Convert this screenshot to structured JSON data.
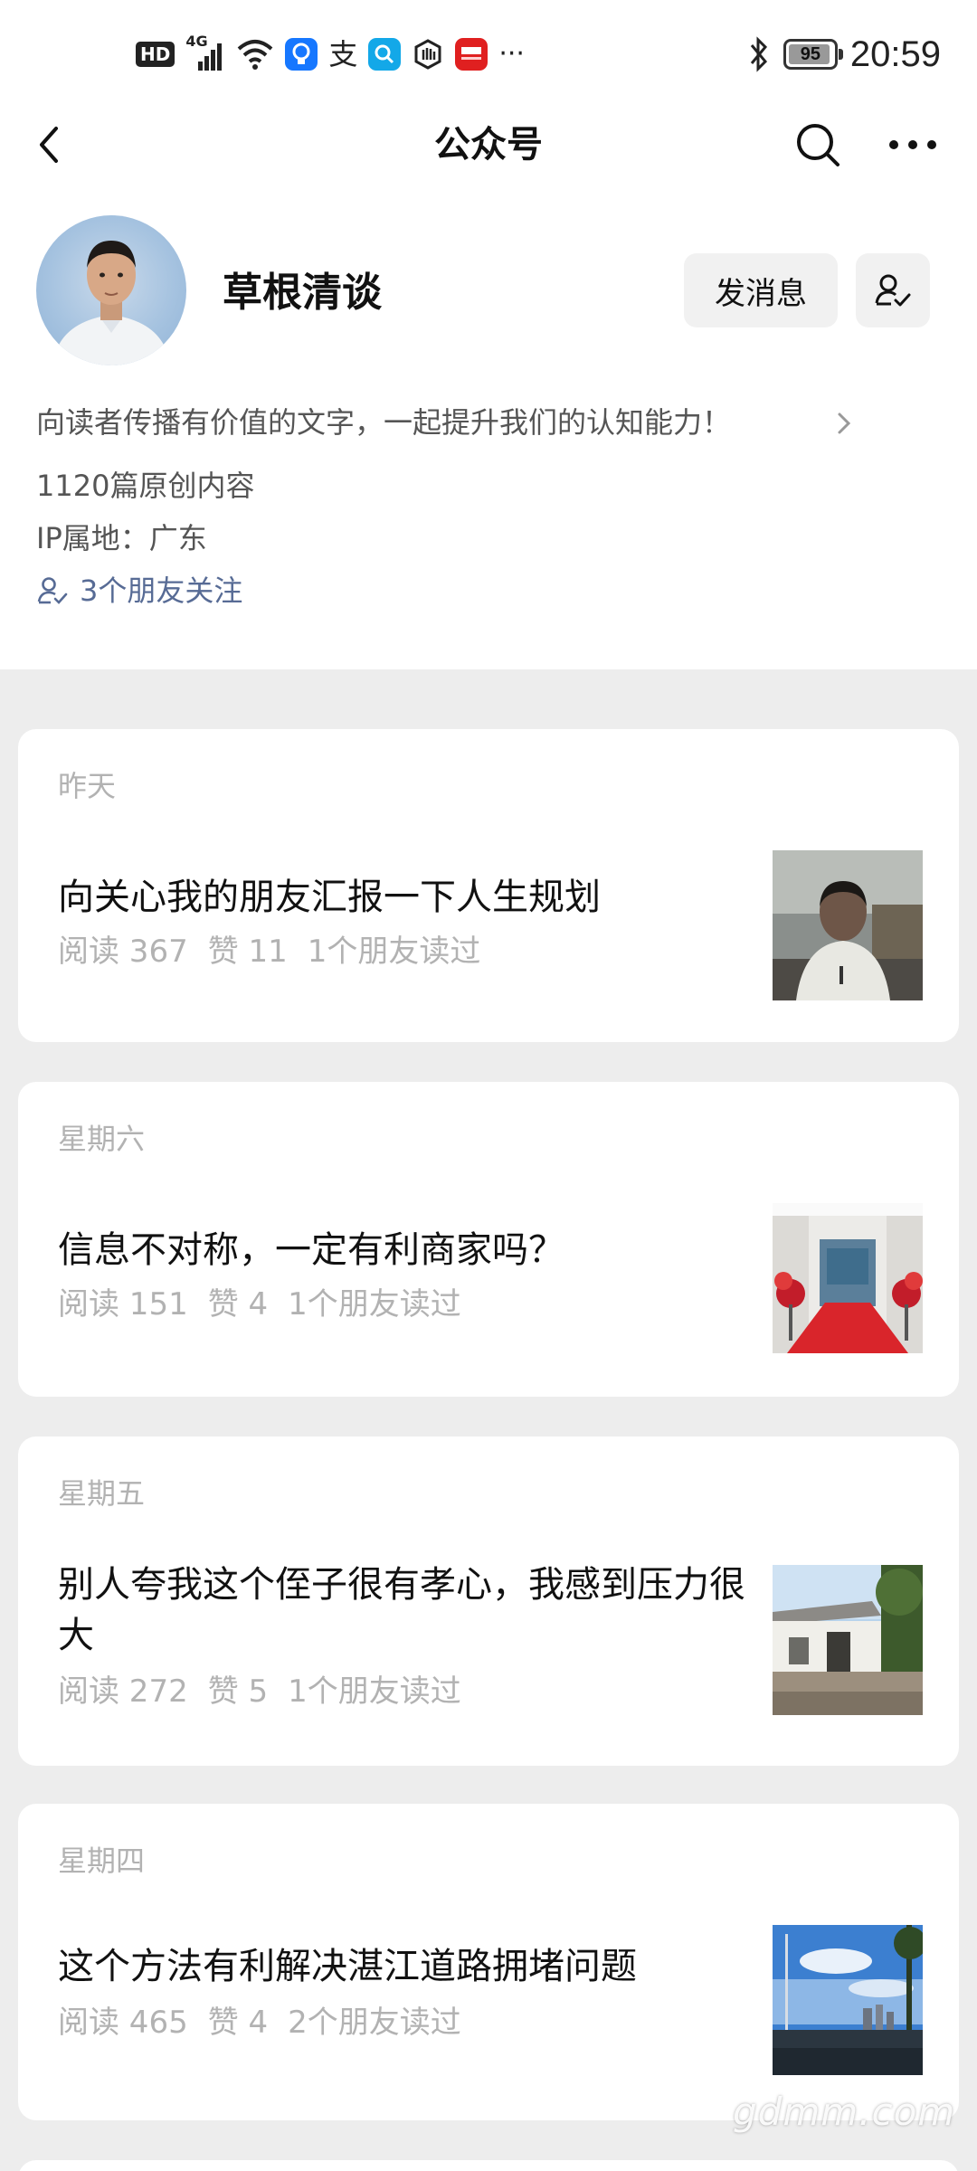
{
  "status_bar": {
    "left_labels": {
      "hd": "HD",
      "network": "4G"
    },
    "icons": [
      "hd-icon",
      "signal-icon",
      "wifi-icon",
      "bulb-app-icon",
      "alipay-icon",
      "search-app-icon",
      "hand-app-icon",
      "news-app-icon",
      "more-dots-icon"
    ],
    "more": "···",
    "battery": "95",
    "battery_level": 0.95,
    "time": "20:59"
  },
  "nav": {
    "title": "公众号"
  },
  "profile": {
    "name": "草根清谈",
    "message_button": "发消息",
    "bio": "向读者传播有价值的文字，一起提升我们的认知能力！",
    "original_count": "1120篇原创内容",
    "ip_location": "IP属地：广东",
    "friends_following": "3个朋友关注"
  },
  "articles": [
    {
      "date": "昨天",
      "title": "向关心我的朋友汇报一下人生规划",
      "reads": "阅读 367",
      "likes": "赞 11",
      "friends_read": "1个朋友读过"
    },
    {
      "date": "星期六",
      "title": "信息不对称，一定有利商家吗？",
      "reads": "阅读 151",
      "likes": "赞 4",
      "friends_read": "1个朋友读过"
    },
    {
      "date": "星期五",
      "title": "别人夸我这个侄子很有孝心，我感到压力很大",
      "reads": "阅读 272",
      "likes": "赞 5",
      "friends_read": "1个朋友读过"
    },
    {
      "date": "星期四",
      "title": "这个方法有利解决湛江道路拥堵问题",
      "reads": "阅读 465",
      "likes": "赞 4",
      "friends_read": "2个朋友读过"
    }
  ],
  "colors": {
    "link_blue": "#576b95",
    "muted_gray": "#b2b2b2",
    "page_bg": "#ededed"
  },
  "watermark": "gdmm.com"
}
